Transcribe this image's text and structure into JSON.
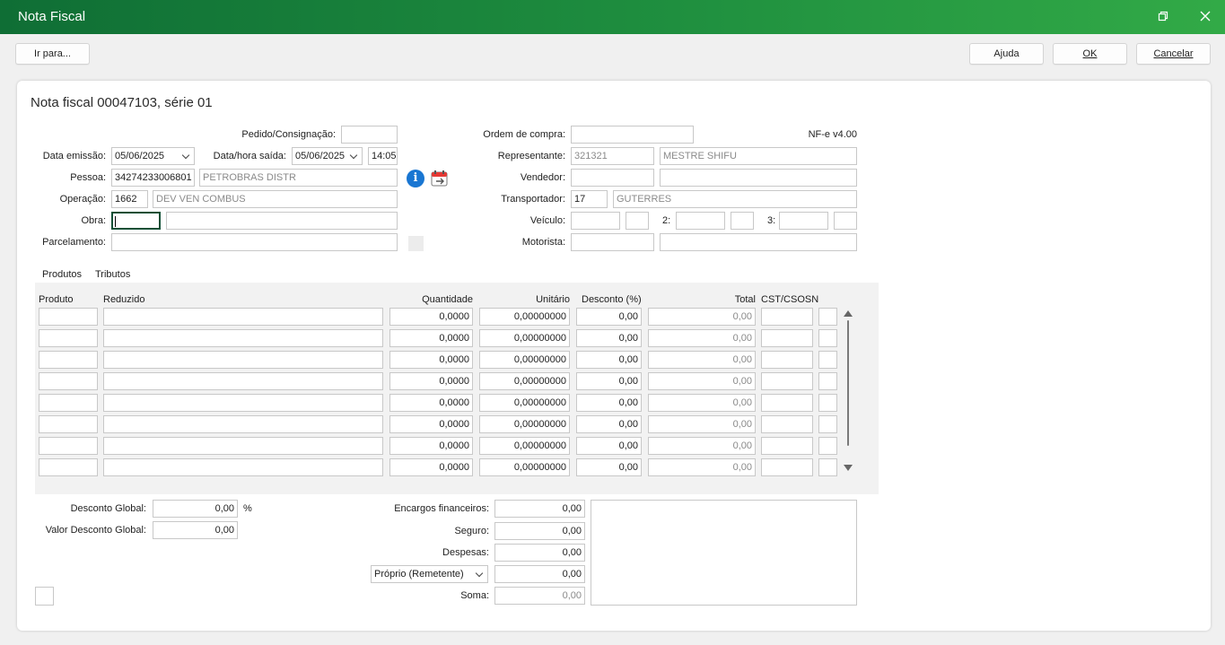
{
  "window": {
    "title": "Nota Fiscal",
    "restore_icon": "restore-window-icon",
    "close_icon": "close-icon"
  },
  "toolbar": {
    "goto_label": "Ir para...",
    "help_label": "Ajuda",
    "ok_label": "OK",
    "cancel_label": "Cancelar"
  },
  "form": {
    "heading": "Nota fiscal 00047103, série 01",
    "nfe_version": "NF-e v4.00",
    "pedido": {
      "label": "Pedido/Consignação:",
      "value": ""
    },
    "data_emissao": {
      "label": "Data emissão:",
      "value": "05/06/2025"
    },
    "data_saida": {
      "label": "Data/hora saída:",
      "date": "05/06/2025",
      "time": "14:05"
    },
    "pessoa": {
      "label": "Pessoa:",
      "code": "34274233006801",
      "name": "PETROBRAS DISTR"
    },
    "operacao": {
      "label": "Operação:",
      "code": "1662",
      "name": "DEV VEN COMBUS"
    },
    "obra": {
      "label": "Obra:",
      "code": "",
      "name": ""
    },
    "parcelamento": {
      "label": "Parcelamento:",
      "value": ""
    },
    "ordem_compra": {
      "label": "Ordem de compra:",
      "value": ""
    },
    "representante": {
      "label": "Representante:",
      "code": "321321",
      "name": "MESTRE SHIFU"
    },
    "vendedor": {
      "label": "Vendedor:",
      "code": "",
      "name": ""
    },
    "transportador": {
      "label": "Transportador:",
      "code": "17",
      "name": "GUTERRES"
    },
    "veiculo": {
      "label": "Veículo:",
      "label2": "2:",
      "label3": "3:"
    },
    "motorista": {
      "label": "Motorista:",
      "code": "",
      "name": ""
    }
  },
  "tabs": [
    {
      "label": "Produtos",
      "active": true
    },
    {
      "label": "Tributos",
      "active": false
    }
  ],
  "grid": {
    "columns": [
      "Produto",
      "Reduzido",
      "Quantidade",
      "Unitário",
      "Desconto (%)",
      "Total",
      "CST/CSOSN"
    ],
    "rows": [
      {
        "produto": "",
        "reduzido": "",
        "quantidade": "0,0000",
        "unitario": "0,00000000",
        "desconto": "0,00",
        "total": "0,00",
        "cst": ""
      },
      {
        "produto": "",
        "reduzido": "",
        "quantidade": "0,0000",
        "unitario": "0,00000000",
        "desconto": "0,00",
        "total": "0,00",
        "cst": ""
      },
      {
        "produto": "",
        "reduzido": "",
        "quantidade": "0,0000",
        "unitario": "0,00000000",
        "desconto": "0,00",
        "total": "0,00",
        "cst": ""
      },
      {
        "produto": "",
        "reduzido": "",
        "quantidade": "0,0000",
        "unitario": "0,00000000",
        "desconto": "0,00",
        "total": "0,00",
        "cst": ""
      },
      {
        "produto": "",
        "reduzido": "",
        "quantidade": "0,0000",
        "unitario": "0,00000000",
        "desconto": "0,00",
        "total": "0,00",
        "cst": ""
      },
      {
        "produto": "",
        "reduzido": "",
        "quantidade": "0,0000",
        "unitario": "0,00000000",
        "desconto": "0,00",
        "total": "0,00",
        "cst": ""
      },
      {
        "produto": "",
        "reduzido": "",
        "quantidade": "0,0000",
        "unitario": "0,00000000",
        "desconto": "0,00",
        "total": "0,00",
        "cst": ""
      },
      {
        "produto": "",
        "reduzido": "",
        "quantidade": "0,0000",
        "unitario": "0,00000000",
        "desconto": "0,00",
        "total": "0,00",
        "cst": ""
      }
    ]
  },
  "totals": {
    "desconto_global": {
      "label": "Desconto Global:",
      "value": "0,00",
      "unit": "%"
    },
    "valor_desconto_global": {
      "label": "Valor Desconto Global:",
      "value": "0,00"
    },
    "encargos": {
      "label": "Encargos financeiros:",
      "value": "0,00"
    },
    "seguro": {
      "label": "Seguro:",
      "value": "0,00"
    },
    "despesas": {
      "label": "Despesas:",
      "value": "0,00"
    },
    "frete": {
      "select": "Próprio (Remetente)",
      "value": "0,00"
    },
    "soma": {
      "label": "Soma:",
      "value": "0,00"
    }
  },
  "colors": {
    "titlebar_start": "#0f6e35",
    "titlebar_end": "#32aa47",
    "info_icon": "#1976d2",
    "focus_border": "#0f4f35"
  }
}
